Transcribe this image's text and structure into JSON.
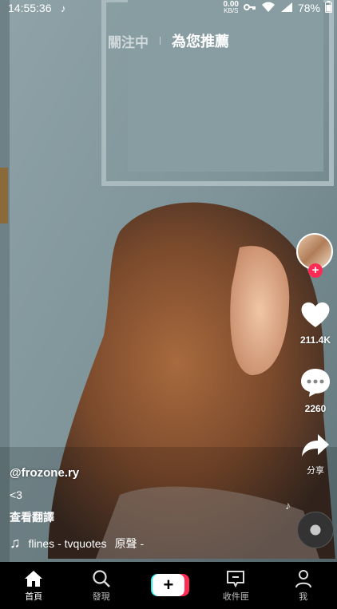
{
  "status_bar": {
    "time": "14:55:36",
    "net_speed_value": "0.00",
    "net_speed_unit": "KB/S",
    "battery": "78%"
  },
  "top_tabs": {
    "following": "關注中",
    "for_you": "為您推薦"
  },
  "actions": {
    "likes": "211.4K",
    "comments": "2260",
    "share_label": "分享"
  },
  "caption": {
    "username": "@frozone.ry",
    "description": "<3",
    "see_translation": "查看翻譯",
    "music": "flines - tvquotes",
    "original_sound": "原聲 -"
  },
  "bottom_nav": {
    "home": "首頁",
    "discover": "發現",
    "inbox": "收件匣",
    "me": "我"
  },
  "colors": {
    "accent_red": "#fe2c55",
    "accent_cyan": "#25f4ee"
  }
}
